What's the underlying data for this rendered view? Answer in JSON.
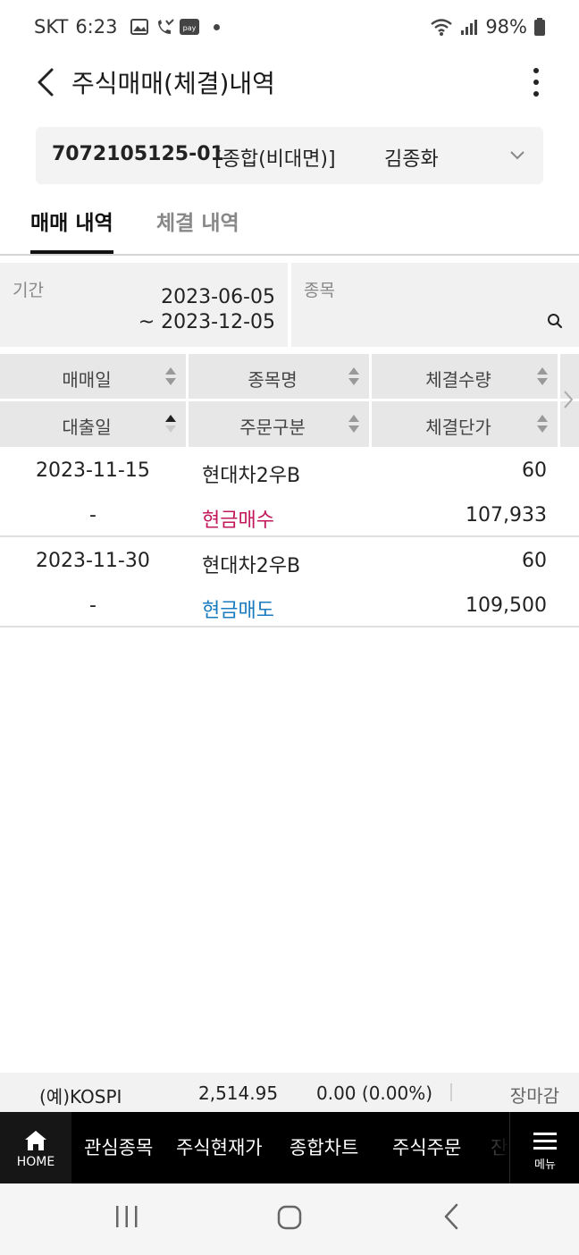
{
  "status_bar": {
    "carrier": "SKT",
    "time": "6:23",
    "battery": "98%",
    "icons": [
      "gallery-icon",
      "missed-call-icon",
      "pay-icon",
      "wifi-icon",
      "signal-icon",
      "battery-icon"
    ]
  },
  "header": {
    "title": "주식매매(체결)내역"
  },
  "account": {
    "number": "7072105125-01",
    "type": "[종합(비대면)]",
    "owner": "김종화"
  },
  "tabs": [
    {
      "label": "매매 내역",
      "active": true
    },
    {
      "label": "체결 내역",
      "active": false
    }
  ],
  "filters": {
    "period_label": "기간",
    "period_from": "2023-06-05",
    "period_to": "~ 2023-12-05",
    "stock_label": "종목"
  },
  "table": {
    "headers_top": [
      "매매일",
      "종목명",
      "체결수량"
    ],
    "headers_bottom": [
      "대출일",
      "주문구분",
      "체결단가"
    ],
    "rows": [
      {
        "trade_date": "2023-11-15",
        "loan_date": "-",
        "stock": "현대차2우B",
        "order_type": "현금매수",
        "quantity": "60",
        "price": "107,933"
      },
      {
        "trade_date": "2023-11-30",
        "loan_date": "-",
        "stock": "현대차2우B",
        "order_type": "현금매도",
        "quantity": "60",
        "price": "109,500"
      }
    ]
  },
  "ticker": {
    "name": "(예)KOSPI",
    "value": "2,514.95",
    "change": "0.00 (0.00%)",
    "status": "장마감"
  },
  "bottom_nav": {
    "home_label": "HOME",
    "items": [
      "관심종목",
      "주식현재가",
      "종합차트",
      "주식주문",
      "잔"
    ],
    "menu_label": "메뉴"
  },
  "colors": {
    "buy": "#c2185b",
    "sell": "#1a7bbf",
    "nav_background": "#000000"
  }
}
